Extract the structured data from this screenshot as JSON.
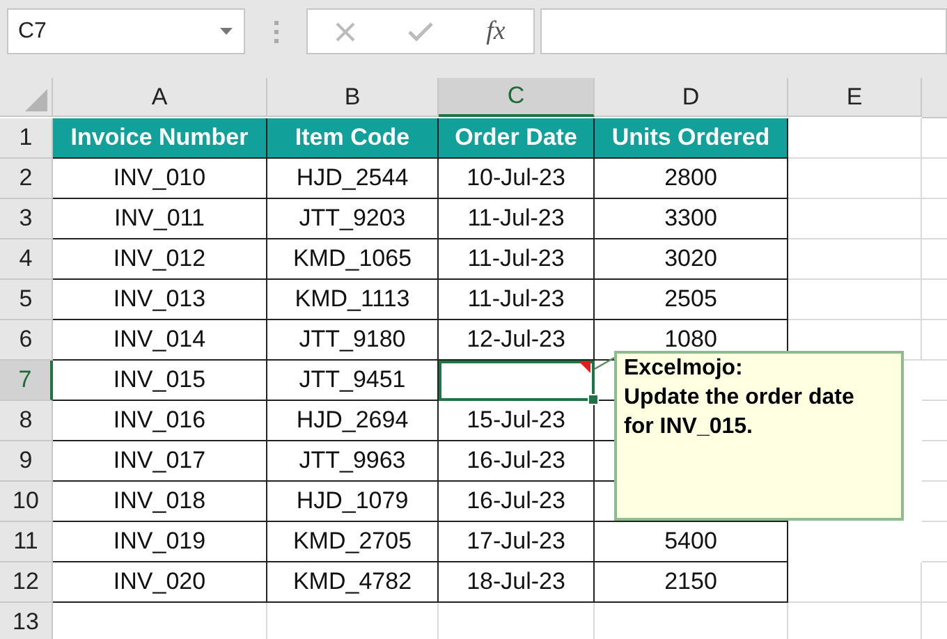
{
  "name_box": {
    "value": "C7"
  },
  "formula_bar": {
    "function_button": "fx"
  },
  "columns": [
    {
      "label": "A",
      "selected": false
    },
    {
      "label": "B",
      "selected": false
    },
    {
      "label": "C",
      "selected": true
    },
    {
      "label": "D",
      "selected": false
    },
    {
      "label": "E",
      "selected": false
    }
  ],
  "header_row": {
    "label": "1",
    "cells": [
      "Invoice Number",
      "Item Code",
      "Order Date",
      "Units Ordered"
    ]
  },
  "rows": [
    {
      "label": "2",
      "selected": false,
      "cells": [
        "INV_010",
        "HJD_2544",
        "10-Jul-23",
        "2800",
        ""
      ]
    },
    {
      "label": "3",
      "selected": false,
      "cells": [
        "INV_011",
        "JTT_9203",
        "11-Jul-23",
        "3300",
        ""
      ]
    },
    {
      "label": "4",
      "selected": false,
      "cells": [
        "INV_012",
        "KMD_1065",
        "11-Jul-23",
        "3020",
        ""
      ]
    },
    {
      "label": "5",
      "selected": false,
      "cells": [
        "INV_013",
        "KMD_1113",
        "11-Jul-23",
        "2505",
        ""
      ]
    },
    {
      "label": "6",
      "selected": false,
      "cells": [
        "INV_014",
        "JTT_9180",
        "12-Jul-23",
        "1080",
        ""
      ]
    },
    {
      "label": "7",
      "selected": true,
      "cells": [
        "INV_015",
        "JTT_9451",
        "",
        "",
        ""
      ]
    },
    {
      "label": "8",
      "selected": false,
      "cells": [
        "INV_016",
        "HJD_2694",
        "15-Jul-23",
        "",
        ""
      ]
    },
    {
      "label": "9",
      "selected": false,
      "cells": [
        "INV_017",
        "JTT_9963",
        "16-Jul-23",
        "",
        ""
      ]
    },
    {
      "label": "10",
      "selected": false,
      "cells": [
        "INV_018",
        "HJD_1079",
        "16-Jul-23",
        "",
        ""
      ]
    },
    {
      "label": "11",
      "selected": false,
      "cells": [
        "INV_019",
        "KMD_2705",
        "17-Jul-23",
        "5400",
        ""
      ]
    },
    {
      "label": "12",
      "selected": false,
      "cells": [
        "INV_020",
        "KMD_4782",
        "18-Jul-23",
        "2150",
        ""
      ]
    },
    {
      "label": "13",
      "selected": false,
      "cells": [
        "",
        "",
        "",
        "",
        ""
      ]
    }
  ],
  "comment": {
    "author": "Excelmojo:",
    "text": "Update the order date for INV_015."
  }
}
